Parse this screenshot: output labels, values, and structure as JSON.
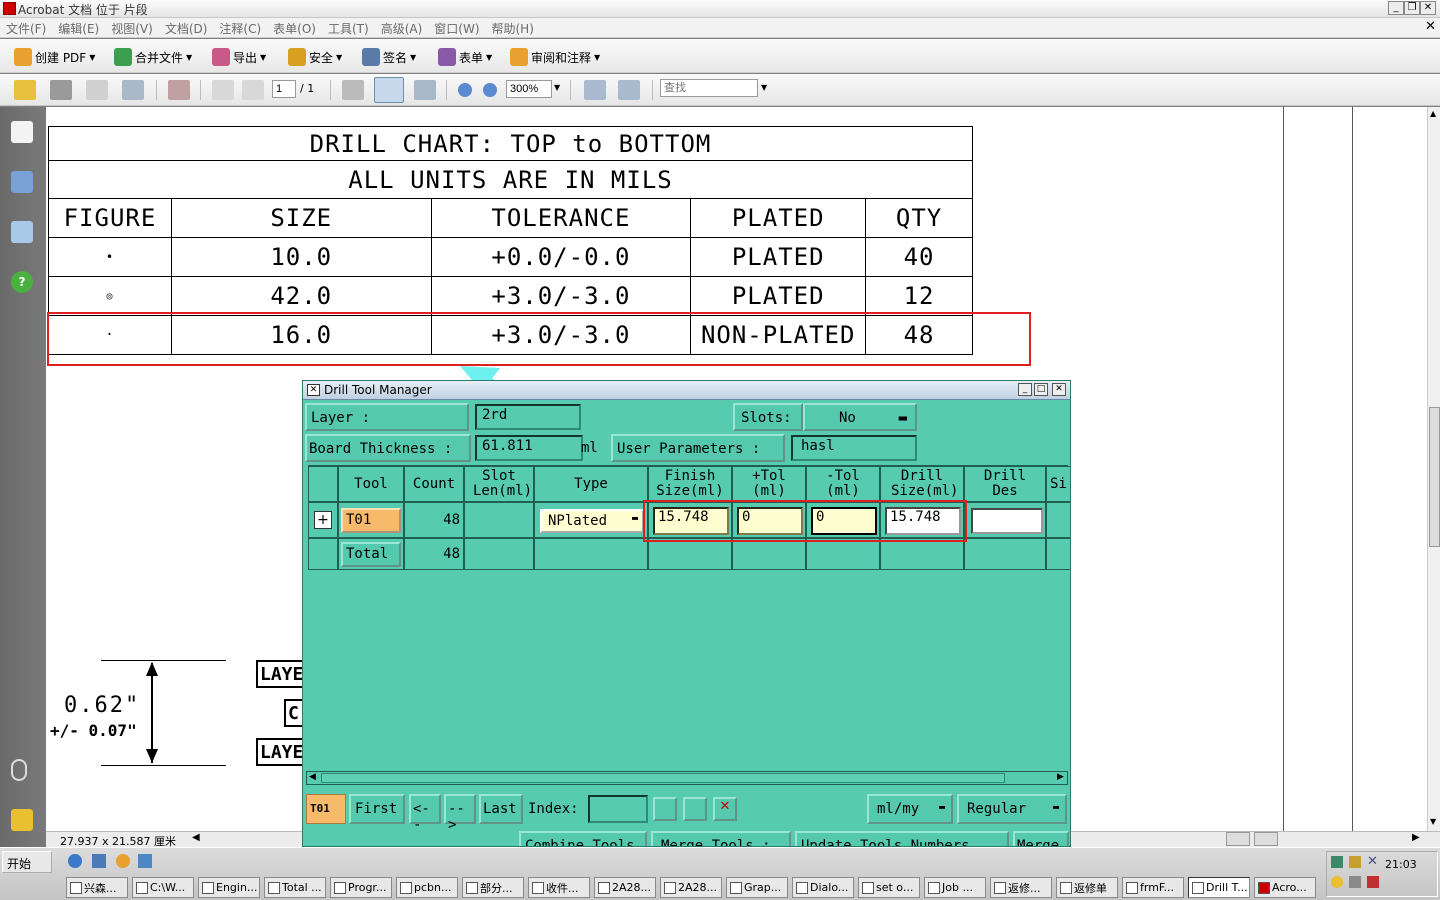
{
  "window": {
    "title": "Acrobat 文档 位于 片段",
    "accent": "#5ccfb4"
  },
  "menu": [
    "文件(F)",
    "编辑(E)",
    "视图(V)",
    "文档(D)",
    "注释(C)",
    "表单(O)",
    "工具(T)",
    "高级(A)",
    "窗口(W)",
    "帮助(H)"
  ],
  "toolbar1": {
    "create_pdf": "创建 PDF",
    "combine": "合并文件",
    "export": "导出",
    "secure": "安全",
    "sign": "签名",
    "forms": "表单",
    "review": "审阅和注释"
  },
  "toolbar2": {
    "page_current": "1",
    "page_total": "/ 1",
    "zoom": "300%",
    "search_placeholder": "查找"
  },
  "drill_chart": {
    "title": "DRILL CHART: TOP to BOTTOM",
    "subtitle": "ALL UNITS ARE IN MILS",
    "headers": [
      "FIGURE",
      "SIZE",
      "TOLERANCE",
      "PLATED",
      "QTY"
    ],
    "rows": [
      {
        "figure": "•",
        "size": "10.0",
        "tolerance": "+0.0/-0.0",
        "plated": "PLATED",
        "qty": "40"
      },
      {
        "figure": "◎",
        "size": "42.0",
        "tolerance": "+3.0/-3.0",
        "plated": "PLATED",
        "qty": "12"
      },
      {
        "figure": "·",
        "size": "16.0",
        "tolerance": "+3.0/-3.0",
        "plated": "NON-PLATED",
        "qty": "48"
      }
    ]
  },
  "dimension": {
    "value": "0.62\"",
    "tolerance": "+/- 0.07\"",
    "layer_top": "LAYE",
    "layer_mid": "C",
    "layer_bottom": "LAYE"
  },
  "dialog": {
    "title": "Drill Tool Manager",
    "layer_label": "Layer            :",
    "layer_value": "2rd",
    "slots_label": "Slots:",
    "slots_value": "No",
    "board_thickness_label": "Board Thickness :",
    "board_thickness_value": "61.811",
    "board_thickness_unit": "ml",
    "user_params_label": "User Parameters :",
    "user_params_value": "hasl",
    "columns": [
      "Tool",
      "Count",
      "Slot Len(ml)",
      "Type",
      "Finish Size(ml)",
      "+Tol (ml)",
      "-Tol (ml)",
      "Drill Size(ml)",
      "Drill Des",
      "Si"
    ],
    "row": {
      "tool": "T01",
      "count": "48",
      "type": "NPlated",
      "finish": "15.748",
      "ptol": "0",
      "mtol": "0",
      "drill": "15.748",
      "des": ""
    },
    "total_label": "Total",
    "total_count": "48",
    "bottom": {
      "current": "T01",
      "first": "First",
      "prev": "<--",
      "next": "-->",
      "last": "Last",
      "index_label": "Index:",
      "units": "ml/my",
      "mode": "Regular"
    },
    "footer_buttons": [
      "Combine Tools",
      "Merge Tools :",
      "Update Tools Numbers",
      "Merge"
    ]
  },
  "statusbar": {
    "page_size": "27.937 x 21.587 厘米"
  },
  "taskbar": {
    "start": "开始",
    "clock": "21:03",
    "tasks": [
      "兴森...",
      "C:\\W...",
      "Engin...",
      "Total ...",
      "Progr...",
      "pcbn...",
      "部分...",
      "收件...",
      "2A28...",
      "2A28...",
      "Grap...",
      "Dialo...",
      "set o...",
      "Job ...",
      "返修...",
      "返修单",
      "frmF...",
      "Drill T...",
      "Acro..."
    ]
  }
}
